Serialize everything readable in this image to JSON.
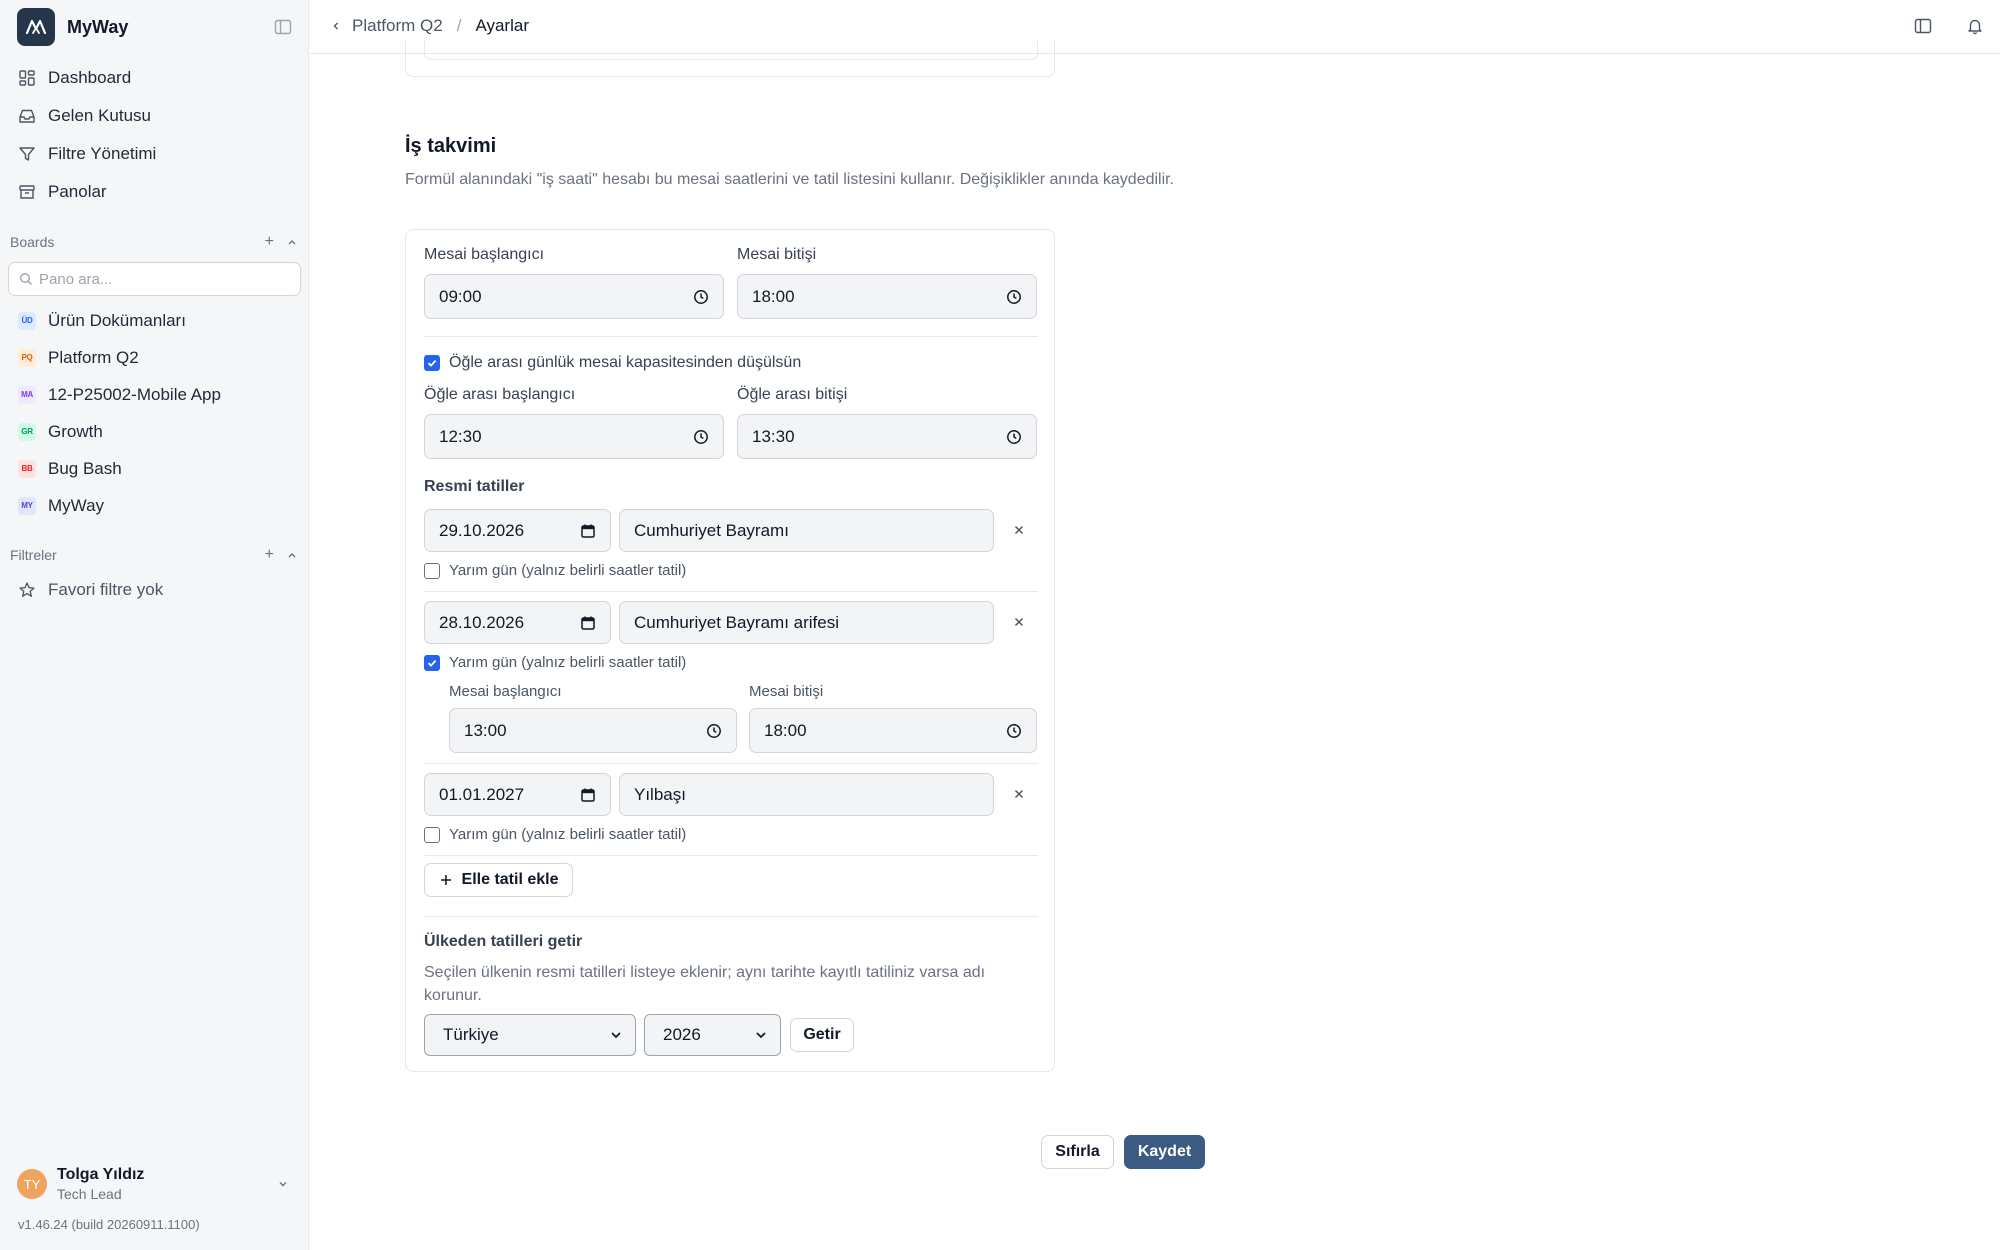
{
  "sidebar": {
    "brand": "MyWay",
    "nav": [
      {
        "label": "Dashboard",
        "icon": "dashboard-icon"
      },
      {
        "label": "Gelen Kutusu",
        "icon": "inbox-icon"
      },
      {
        "label": "Filtre Yönetimi",
        "icon": "filter-icon"
      },
      {
        "label": "Panolar",
        "icon": "archive-icon"
      }
    ],
    "boards_heading": "Boards",
    "board_search_placeholder": "Pano ara...",
    "boards": [
      {
        "badge": "ÜD",
        "label": "Ürün Dokümanları",
        "bg": "#dbeafe",
        "fg": "#2563eb"
      },
      {
        "badge": "PQ",
        "label": "Platform Q2",
        "bg": "#ffedd5",
        "fg": "#ea580c"
      },
      {
        "badge": "MA",
        "label": "12-P25002-Mobile App",
        "bg": "#ede9fe",
        "fg": "#7c3aed"
      },
      {
        "badge": "GR",
        "label": "Growth",
        "bg": "#d1fae5",
        "fg": "#059669"
      },
      {
        "badge": "BB",
        "label": "Bug Bash",
        "bg": "#fee2e2",
        "fg": "#dc2626"
      },
      {
        "badge": "MY",
        "label": "MyWay",
        "bg": "#e0e7ff",
        "fg": "#4f46e5"
      }
    ],
    "filters_heading": "Filtreler",
    "favorite_empty": "Favori filtre yok",
    "user": {
      "initials": "TY",
      "name": "Tolga Yıldız",
      "role": "Tech Lead"
    },
    "version": "v1.46.24 (build 20260911.1100)"
  },
  "topbar": {
    "breadcrumb_parent": "Platform Q2",
    "breadcrumb_sep": "/",
    "breadcrumb_current": "Ayarlar"
  },
  "schedule": {
    "title": "İş takvimi",
    "description": "Formül alanındaki \"iş saati\" hesabı bu mesai saatlerini ve tatil listesini kullanır. Değişiklikler anında kaydedilir.",
    "work_start_label": "Mesai başlangıcı",
    "work_start": "09:00",
    "work_end_label": "Mesai bitişi",
    "work_end": "18:00",
    "lunch_deduct_label": "Öğle arası günlük mesai kapasitesinden düşülsün",
    "lunch_deduct_checked": true,
    "lunch_start_label": "Öğle arası başlangıcı",
    "lunch_start": "12:30",
    "lunch_end_label": "Öğle arası bitişi",
    "lunch_end": "13:30",
    "holidays_heading": "Resmi tatiller",
    "half_day_label": "Yarım gün (yalnız belirli saatler tatil)",
    "holidays": [
      {
        "date": "29.10.2026",
        "name": "Cumhuriyet Bayramı",
        "half_day": false
      },
      {
        "date": "28.10.2026",
        "name": "Cumhuriyet Bayramı arifesi",
        "half_day": true,
        "half_start_label": "Mesai başlangıcı",
        "half_start": "13:00",
        "half_end_label": "Mesai bitişi",
        "half_end": "18:00"
      },
      {
        "date": "01.01.2027",
        "name": "Yılbaşı",
        "half_day": false
      }
    ],
    "add_holiday_label": "Elle tatil ekle",
    "country_heading": "Ülkeden tatilleri getir",
    "country_desc": "Seçilen ülkenin resmi tatilleri listeye eklenir; aynı tarihte kayıtlı tatiliniz varsa adı korunur.",
    "country_selected": "Türkiye",
    "year_selected": "2026",
    "fetch_label": "Getir"
  },
  "footer": {
    "reset_label": "Sıfırla",
    "save_label": "Kaydet"
  }
}
